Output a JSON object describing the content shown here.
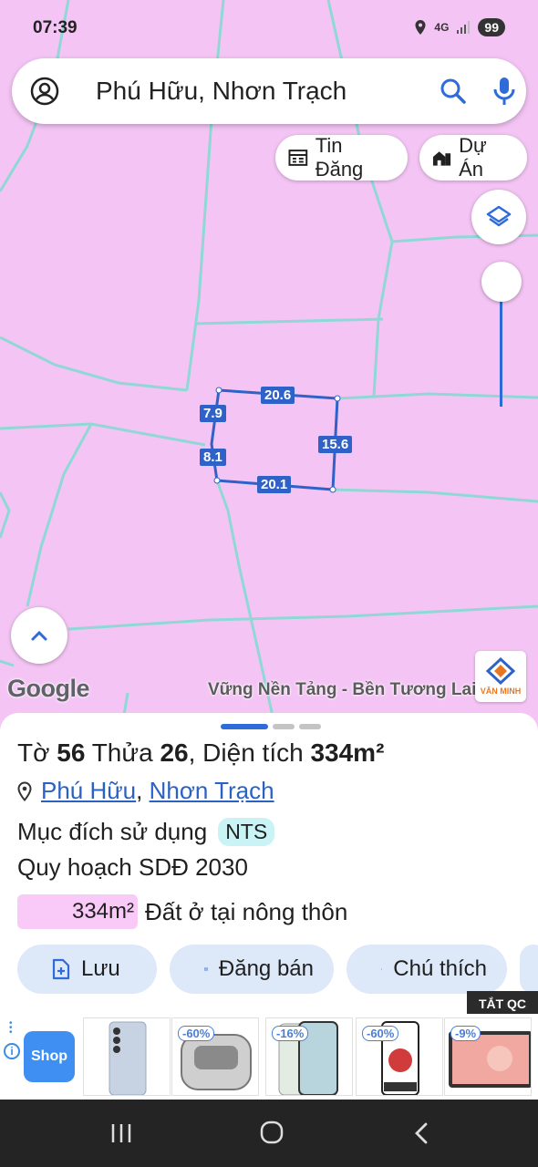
{
  "status_bar": {
    "time": "07:39",
    "network": "4G",
    "battery": "99"
  },
  "search": {
    "query": "Phú Hữu, Nhơn Trạch"
  },
  "chips": {
    "listings": "Tin Đăng",
    "projects": "Dự Án"
  },
  "map": {
    "dimensions": {
      "top": "20.6",
      "right": "15.6",
      "bottom": "20.1",
      "left_upper": "7.9",
      "left_lower": "8.1"
    },
    "google_logo": "Google",
    "watermark": "Vững Nền Tảng - Bền Tương Lai",
    "brand_logo": "VĂN MINH"
  },
  "parcel": {
    "prefix_sheet": "Tờ",
    "sheet_no": "56",
    "prefix_plot": "Thửa",
    "plot_no": "26",
    "prefix_area": ", Diện tích",
    "area": "334m²",
    "commune": "Phú Hữu",
    "district": "Nhơn Trạch",
    "purpose_label": "Mục đích sử dụng",
    "purpose_code": "NTS",
    "plan_label": "Quy hoạch SDĐ 2030",
    "land_area": "334m²",
    "land_type": "Đất ở tại nông thôn"
  },
  "actions": {
    "save": "Lưu",
    "post_sale": "Đăng bán",
    "legend": "Chú thích"
  },
  "ad": {
    "close_label": "TẮT QC",
    "shop_label": "Shop",
    "discounts": [
      "-60%",
      "-16%",
      "-60%",
      "-9%"
    ]
  },
  "colors": {
    "map_bg": "#f4c5f4",
    "boundary": "#8ed8d8",
    "parcel": "#2f62c9",
    "accent": "#2f6bd9"
  }
}
